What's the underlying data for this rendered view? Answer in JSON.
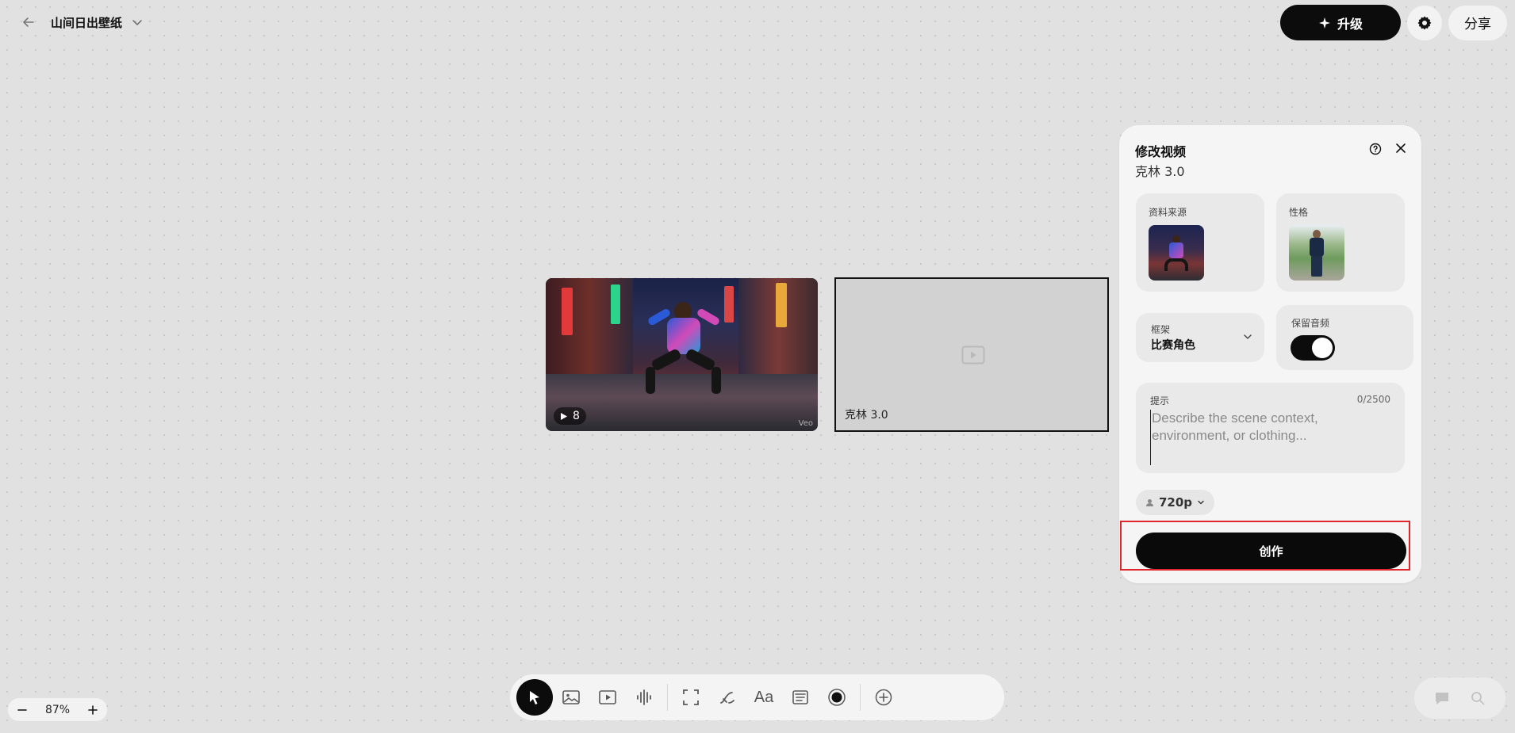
{
  "header": {
    "project_title": "山间日出壁纸",
    "upgrade_label": "升级",
    "share_label": "分享"
  },
  "canvas": {
    "video_node": {
      "play_count": "8",
      "watermark": "Veo"
    },
    "placeholder_node": {
      "label": "克林 3.0"
    }
  },
  "panel": {
    "title": "修改视频",
    "subtitle": "克林 3.0",
    "source_label": "资料来源",
    "role_label": "性格",
    "frame_label": "框架",
    "frame_value": "比赛角色",
    "audio_label": "保留音频",
    "audio_enabled": true,
    "prompt_label": "提示",
    "prompt_count": "0/2500",
    "prompt_value": "",
    "prompt_placeholder": "Describe the scene context, environment, or clothing...",
    "quality": "720p",
    "create_label": "创作"
  },
  "zoom": {
    "value": "87%"
  },
  "toolbar": {
    "tools": [
      "select-tool",
      "image-tool",
      "video-tool",
      "audio-tool",
      "frame-tool",
      "draw-tool",
      "text-tool",
      "note-tool",
      "record-tool",
      "add-tool"
    ],
    "active": "select-tool",
    "text_tool_label": "Aa"
  },
  "colors": {
    "accent": "#0c0c0c",
    "highlight": "#e0262b",
    "canvas_bg": "#e1e1e1"
  }
}
